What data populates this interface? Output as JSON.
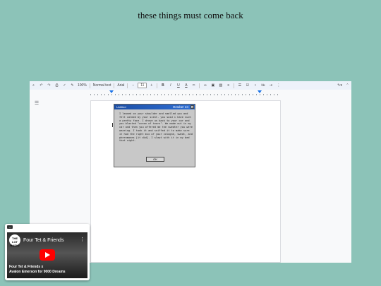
{
  "headline": "these things must come back",
  "toolbar": {
    "zoom": "100%",
    "style": "Normal text",
    "font": "Arial",
    "font_size": "11",
    "minus": "−",
    "plus": "+",
    "bold": "B",
    "italic": "I",
    "underline": "U",
    "text_color": "A"
  },
  "dialog": {
    "title": "Untitled",
    "date": "October 24",
    "body": "I leaned on your shoulder and smelled you and felt calmed by your scent. you said i have such a pretty face. I drove us back to your car and you blasted \"ocean of tears\". We made out in my car and then you offered me the sweater you were wearing. I took it and sniffed it to make sure it had the right mix of your cologne, sweat, and pheromones [it did]. I slept with it in my bed that night.",
    "ok": "OK",
    "close": "×"
  },
  "video": {
    "title": "Four Tet & Friends",
    "logo": "THE LOT RADIO",
    "caption_line1": "Four Tet & Friends x",
    "caption_line2": "Avalon Emerson for 9000 Dreams"
  }
}
